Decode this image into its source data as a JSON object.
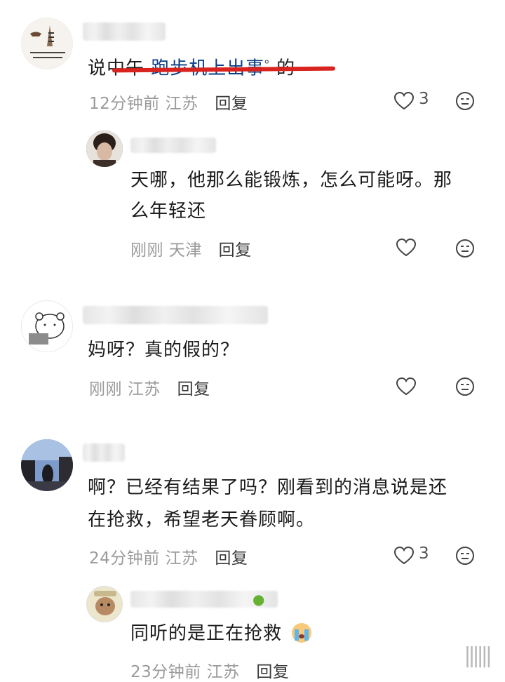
{
  "comments": [
    {
      "text_prefix": "说中午 ",
      "text_keyword": "跑步机上出事",
      "text_search_icon": "ᵒ",
      "text_suffix": " 的",
      "time": "12分钟前",
      "location": "江苏",
      "reply_label": "回复",
      "likes": "3"
    },
    {
      "text_line1": "天哪，他那么能锻炼，怎么可能呀。那",
      "text_line2": "么年轻还",
      "time": "刚刚",
      "location": "天津",
      "reply_label": "回复"
    },
    {
      "text": "妈呀？真的假的？",
      "time": "刚刚",
      "location": "江苏",
      "reply_label": "回复"
    },
    {
      "text_line1": "啊？已经有结果了吗？刚看到的消息说是还",
      "text_line2": "在抢救，希望老天眷顾啊。",
      "time": "24分钟前",
      "location": "江苏",
      "reply_label": "回复",
      "likes": "3"
    },
    {
      "text": "同听的是正在抢救",
      "time": "23分钟前",
      "location": "江苏",
      "reply_label": "回复"
    }
  ],
  "icons": {
    "like": "heart-outline-icon",
    "dislike": "neutral-face-icon",
    "search": "search-icon",
    "crying_emoji": "crying-emoji-icon"
  },
  "colors": {
    "keyword": "#0c3f86",
    "underline": "#d8231e",
    "meta": "#9a9a9a"
  }
}
